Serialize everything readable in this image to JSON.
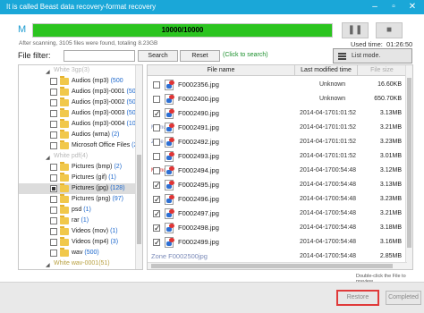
{
  "window": {
    "title": "It is called Beast data recovery-format recovery"
  },
  "mode_label": "M",
  "progress": {
    "text": "10000/10000",
    "fraction": 1.0
  },
  "stats_text": "After scanning, 3105 files were found, totaling 8.23GB",
  "used_time": {
    "label": "Used time:",
    "value": "01:26:50"
  },
  "filter": {
    "label": "File filter:",
    "value": "",
    "search": "Search",
    "reset": "Reset",
    "hint": "(Click to search)"
  },
  "list_mode": "List mode.",
  "tree": [
    {
      "label": "White 3gp(3)",
      "kind": "group"
    },
    {
      "label": "Audios (mp3)",
      "count": "(500"
    },
    {
      "label": "Audios (mp3)-0001",
      "count": "(500"
    },
    {
      "label": "Audios (mp3)-0002",
      "count": "(500"
    },
    {
      "label": "Audios (mp3)-0003",
      "count": "(500"
    },
    {
      "label": "Audios (mp3)-0004",
      "count": "(100"
    },
    {
      "label": "Audios (wma)",
      "count": "(2)"
    },
    {
      "label": "Microsoft Office Files",
      "count": "(2"
    },
    {
      "label": "White pdf(4)",
      "kind": "group"
    },
    {
      "label": "Pictures (bmp)",
      "count": "(2)"
    },
    {
      "label": "Pictures (gif)",
      "count": "(1)"
    },
    {
      "label": "Pictures (jpg)",
      "count": "(128)",
      "selected": true
    },
    {
      "label": "Pictures (png)",
      "count": "(97)"
    },
    {
      "label": "psd",
      "count": "(1)"
    },
    {
      "label": "rar",
      "count": "(1)"
    },
    {
      "label": "Videos (mov)",
      "count": "(1)"
    },
    {
      "label": "Videos (mp4)",
      "count": "(3)"
    },
    {
      "label": "wav",
      "count": "(500)"
    },
    {
      "label": "White wav-0001(51)",
      "kind": "group2"
    }
  ],
  "columns": {
    "name": "File name",
    "date": "Last modified time",
    "size": "File size"
  },
  "files": [
    {
      "name": "F0002356.jpg",
      "date": "Unknown",
      "size": "16.60KB",
      "checked": false
    },
    {
      "name": "F0002400.jpg",
      "date": "Unknown",
      "size": "650.70KB",
      "checked": false
    },
    {
      "name": "F0002490.jpg",
      "date": "2014-04-1701:01:52",
      "size": "3.13MB",
      "checked": true
    },
    {
      "name": "F0002491.jpg",
      "date": "2014-04-1701:01:52",
      "size": "3.21MB",
      "checked": false,
      "ghost": "Memo"
    },
    {
      "name": "F0002492.jpg",
      "date": "2014-04-1701:01:52",
      "size": "3.23MB",
      "checked": false,
      "ghost": "Zone"
    },
    {
      "name": "F0002493.jpg",
      "date": "2014-04-1701:01:52",
      "size": "3.01MB",
      "checked": false
    },
    {
      "name": "F0002494.jpg",
      "date": "2014-04-1700:54:48",
      "size": "3.12MB",
      "checked": false,
      "ghost": "Memory",
      "ghost_red": true
    },
    {
      "name": "F0002495.jpg",
      "date": "2014-04-1700:54:48",
      "size": "3.13MB",
      "checked": true
    },
    {
      "name": "F0002496.jpg",
      "date": "2014-04-1700:54:48",
      "size": "3.23MB",
      "checked": true
    },
    {
      "name": "F0002497.jpg",
      "date": "2014-04-1700:54:48",
      "size": "3.21MB",
      "checked": true
    },
    {
      "name": "F0002498.jpg",
      "date": "2014-04-1700:54:48",
      "size": "3.18MB",
      "checked": true
    },
    {
      "name": "F0002499.jpg",
      "date": "2014-04-1700:54:48",
      "size": "3.16MB",
      "checked": true
    }
  ],
  "partial_row": {
    "name": "Zone F0002500jpg",
    "date": "2014-04-1700:54:48",
    "size": "2.85MB"
  },
  "dblclick_hint": "Double-click the File to preview",
  "buttons": {
    "restore": "Restore",
    "completed": "Completed"
  }
}
